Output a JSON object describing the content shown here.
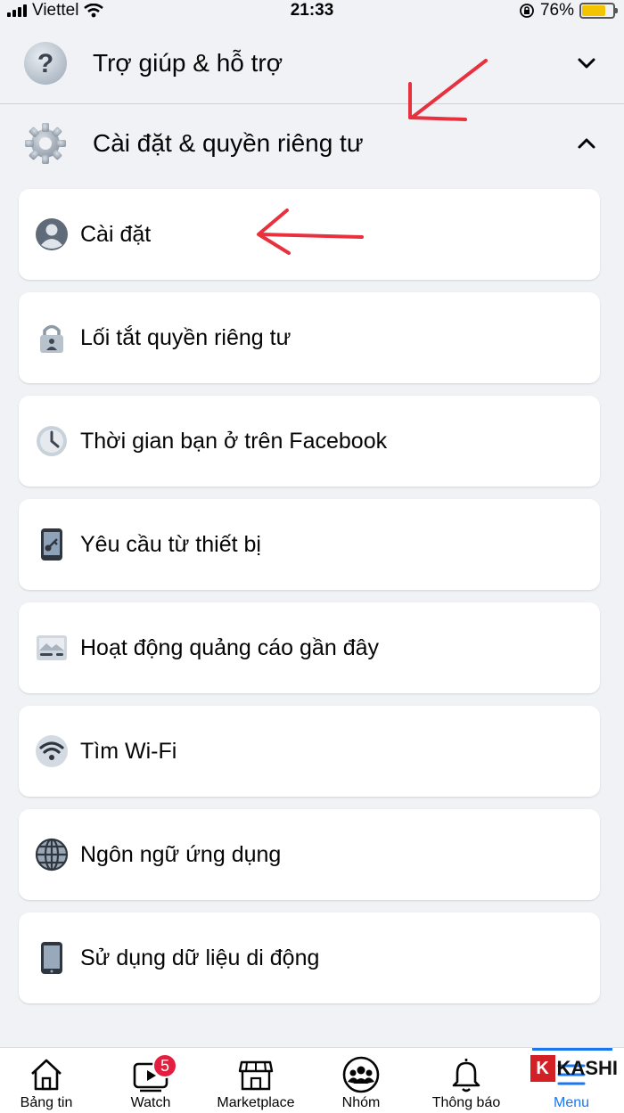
{
  "status_bar": {
    "carrier": "Viettel",
    "time": "21:33",
    "battery": "76%",
    "battery_level": 0.76
  },
  "sections": {
    "help": {
      "title": "Trợ giúp & hỗ trợ",
      "icon": "question-icon",
      "expanded": false
    },
    "settings": {
      "title": "Cài đặt & quyền riêng tư",
      "icon": "gear-icon",
      "expanded": true
    }
  },
  "settings_items": [
    {
      "label": "Cài đặt",
      "icon": "profile-icon"
    },
    {
      "label": "Lối tắt quyền riêng tư",
      "icon": "lock-icon"
    },
    {
      "label": "Thời gian bạn ở trên Facebook",
      "icon": "clock-icon"
    },
    {
      "label": "Yêu cầu từ thiết bị",
      "icon": "phone-key-icon"
    },
    {
      "label": "Hoạt động quảng cáo gần đây",
      "icon": "ad-activity-icon"
    },
    {
      "label": "Tìm Wi-Fi",
      "icon": "wifi-icon"
    },
    {
      "label": "Ngôn ngữ ứng dụng",
      "icon": "globe-icon"
    },
    {
      "label": "Sử dụng dữ liệu di động",
      "icon": "mobile-device-icon"
    }
  ],
  "tabbar": {
    "tabs": [
      {
        "label": "Bảng tin",
        "icon": "home-icon"
      },
      {
        "label": "Watch",
        "icon": "video-icon",
        "badge": "5"
      },
      {
        "label": "Marketplace",
        "icon": "store-icon"
      },
      {
        "label": "Nhóm",
        "icon": "groups-icon"
      },
      {
        "label": "Thông báo",
        "icon": "bell-icon"
      },
      {
        "label": "Menu",
        "icon": "menu-icon",
        "active": true
      }
    ]
  },
  "watermark": {
    "letter": "K",
    "text": "KASHI"
  },
  "colors": {
    "background": "#f0f2f5",
    "accent": "#1877f2",
    "annotation": "#e8303e",
    "badge": "#e41e3f"
  }
}
